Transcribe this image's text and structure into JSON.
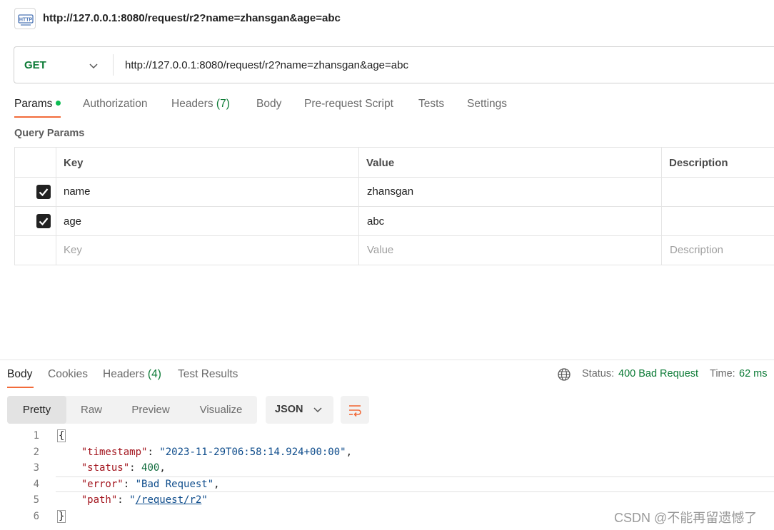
{
  "request": {
    "title": "http://127.0.0.1:8080/request/r2?name=zhansgan&age=abc",
    "method": "GET",
    "url": "http://127.0.0.1:8080/request/r2?name=zhansgan&age=abc"
  },
  "request_tabs": [
    {
      "label": "Params"
    },
    {
      "label": "Authorization"
    },
    {
      "label": "Headers",
      "count": "(7)"
    },
    {
      "label": "Body"
    },
    {
      "label": "Pre-request Script"
    },
    {
      "label": "Tests"
    },
    {
      "label": "Settings"
    }
  ],
  "query_params": {
    "title": "Query Params",
    "columns": [
      "Key",
      "Value",
      "Description"
    ],
    "rows": [
      {
        "checked": true,
        "key": "name",
        "value": "zhansgan",
        "description": ""
      },
      {
        "checked": true,
        "key": "age",
        "value": "abc",
        "description": ""
      }
    ],
    "placeholders": {
      "key": "Key",
      "value": "Value",
      "description": "Description"
    }
  },
  "response_tabs": [
    {
      "label": "Body"
    },
    {
      "label": "Cookies"
    },
    {
      "label": "Headers",
      "count": "(4)"
    },
    {
      "label": "Test Results"
    }
  ],
  "response_status": {
    "status_label": "Status:",
    "status_value": "400 Bad Request",
    "time_label": "Time:",
    "time_value": "62 ms"
  },
  "view_modes": [
    "Pretty",
    "Raw",
    "Preview",
    "Visualize"
  ],
  "format": "JSON",
  "code_lines": {
    "l1": "{",
    "l2_key": "\"timestamp\"",
    "l2_val": "\"2023-11-29T06:58:14.924+00:00\"",
    "l3_key": "\"status\"",
    "l3_val": "400",
    "l4_key": "\"error\"",
    "l4_val": "\"Bad Request\"",
    "l5_key": "\"path\"",
    "l5_q1": "\"",
    "l5_val": "/request/r2",
    "l5_q2": "\"",
    "l6": "}",
    "numbers": [
      "1",
      "2",
      "3",
      "4",
      "5",
      "6"
    ]
  },
  "watermark": "CSDN @不能再留遗憾了",
  "colors": {
    "accent": "#f26b3a",
    "success": "#0b7a35",
    "dot": "#0cbb52"
  }
}
